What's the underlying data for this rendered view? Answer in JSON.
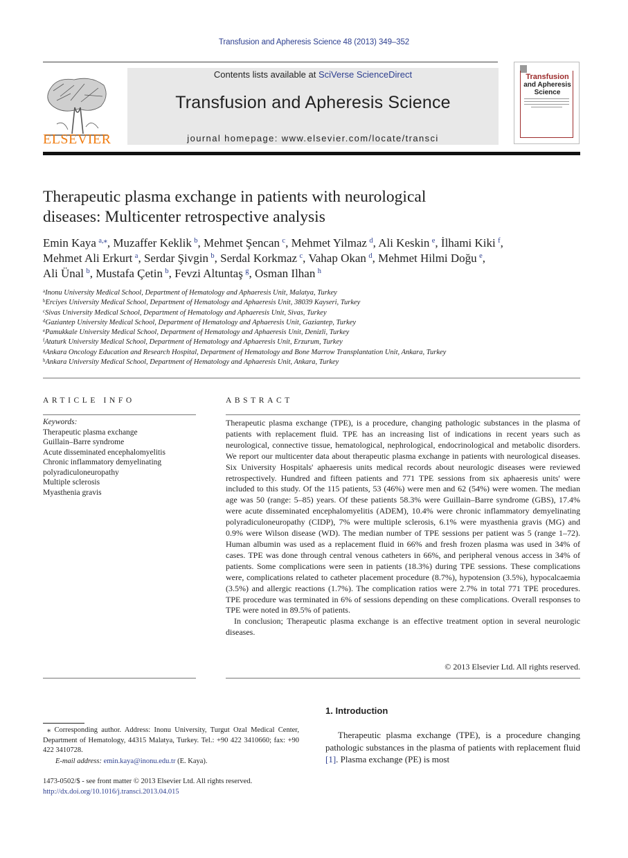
{
  "running_head": "Transfusion and Apheresis Science 48 (2013) 349–352",
  "masthead": {
    "publisher_logo_text": "ELSEVIER",
    "contents_prefix": "Contents lists available at ",
    "contents_link": "SciVerse ScienceDirect",
    "journal_title": "Transfusion and Apheresis Science",
    "homepage_label": "journal homepage: ",
    "homepage_url": "www.elsevier.com/locate/transci",
    "cover": {
      "line1": "Transfusion",
      "line2": "and Apheresis",
      "line3": "Science"
    },
    "accent_color": "#f07c10",
    "link_color": "#2c3e8f"
  },
  "article": {
    "title_line1": "Therapeutic plasma exchange in patients with neurological",
    "title_line2": "diseases: Multicenter retrospective analysis",
    "authors": [
      {
        "name": "Emin Kaya",
        "sup": "a,⁎",
        "sep": ", "
      },
      {
        "name": "Muzaffer Keklik",
        "sup": "b",
        "sep": ", "
      },
      {
        "name": "Mehmet Şencan",
        "sup": "c",
        "sep": ", "
      },
      {
        "name": "Mehmet Yilmaz",
        "sup": "d",
        "sep": ", "
      },
      {
        "name": "Ali Keskin",
        "sup": "e",
        "sep": ", "
      },
      {
        "name": "İlhami Kiki",
        "sup": "f",
        "sep": ","
      },
      {
        "name": "Mehmet Ali Erkurt",
        "sup": "a",
        "sep": ", "
      },
      {
        "name": "Serdar Şivgin",
        "sup": "b",
        "sep": ", "
      },
      {
        "name": "Serdal Korkmaz",
        "sup": "c",
        "sep": ", "
      },
      {
        "name": "Vahap Okan",
        "sup": "d",
        "sep": ", "
      },
      {
        "name": "Mehmet Hilmi Doğu",
        "sup": "e",
        "sep": ","
      },
      {
        "name": "Ali Ünal",
        "sup": "b",
        "sep": ", "
      },
      {
        "name": "Mustafa Çetin",
        "sup": "b",
        "sep": ", "
      },
      {
        "name": "Fevzi Altuntaş",
        "sup": "g",
        "sep": ", "
      },
      {
        "name": "Osman Ilhan",
        "sup": "h",
        "sep": ""
      }
    ],
    "affiliations": [
      {
        "sup": "a",
        "text": "Inonu University Medical School, Department of Hematology and Aphaeresis Unit, Malatya, Turkey"
      },
      {
        "sup": "b",
        "text": "Erciyes University Medical School, Department of Hematology and Aphaeresis Unit, 38039 Kayseri, Turkey"
      },
      {
        "sup": "c",
        "text": "Sivas University Medical School, Department of Hematology and Aphaeresis Unit, Sivas, Turkey"
      },
      {
        "sup": "d",
        "text": "Gaziantep University Medical School, Department of Hematology and Aphaeresis Unit, Gaziantep, Turkey"
      },
      {
        "sup": "e",
        "text": "Pamukkale University Medical School, Department of Hematology and Aphaeresis Unit, Denizli, Turkey"
      },
      {
        "sup": "f",
        "text": "Ataturk University Medical School, Department of Hematology and Aphaeresis Unit, Erzurum, Turkey"
      },
      {
        "sup": "g",
        "text": "Ankara Oncology Education and Research Hospital, Department of Hematology and Bone Marrow Transplantation Unit, Ankara, Turkey"
      },
      {
        "sup": "h",
        "text": "Ankara University Medical School, Department of Hematology and Aphaeresis Unit, Ankara, Turkey"
      }
    ]
  },
  "article_info": {
    "heading": "ARTICLE INFO",
    "keywords_label": "Keywords:",
    "keywords": [
      "Therapeutic plasma exchange",
      "Guillain–Barre syndrome",
      "Acute disseminated encephalomyelitis",
      "Chronic inflammatory demyelinating",
      "polyradiculoneuropathy",
      "Multiple sclerosis",
      "Myasthenia gravis"
    ]
  },
  "abstract": {
    "heading": "ABSTRACT",
    "paragraph1": "Therapeutic plasma exchange (TPE), is a procedure, changing pathologic substances in the plasma of patients with replacement fluid. TPE has an increasing list of indications in recent years such as neurological, connective tissue, hematological, nephrological, endocrinological and metabolic disorders. We report our multicenter data about therapeutic plasma exchange in patients with neurological diseases. Six University Hospitals' aphaeresis units medical records about neurologic diseases were reviewed retrospectively. Hundred and fifteen patients and 771 TPE sessions from six aphaeresis units' were included to this study. Of the 115 patients, 53 (46%) were men and 62 (54%) were women. The median age was 50 (range: 5–85) years. Of these patients 58.3% were Guillain–Barre syndrome (GBS), 17.4% were acute disseminated encephalomyelitis (ADEM), 10.4% were chronic inflammatory demyelinating polyradiculoneuropathy (CIDP), 7% were multiple sclerosis, 6.1% were myasthenia gravis (MG) and 0.9% were Wilson disease (WD). The median number of TPE sessions per patient was 5 (range 1–72). Human albumin was used as a replacement fluid in 66% and fresh frozen plasma was used in 34% of cases. TPE was done through central venous catheters in 66%, and peripheral venous access in 34% of patients. Some complications were seen in patients (18.3%) during TPE sessions. These complications were, complications related to catheter placement procedure (8.7%), hypotension (3.5%), hypocalcaemia (3.5%) and allergic reactions (1.7%). The complication ratios were 2.7% in total 771 TPE procedures. TPE procedure was terminated in 6% of sessions depending on these complications. Overall responses to TPE were noted in 89.5% of patients.",
    "paragraph2": "In conclusion; Therapeutic plasma exchange is an effective treatment option in several neurologic diseases.",
    "copyright": "© 2013 Elsevier Ltd. All rights reserved."
  },
  "footnote": {
    "corresponding": "⁎ Corresponding author. Address: Inonu University, Turgut Ozal Medical Center, Department of Hematology, 44315 Malatya, Turkey. Tel.: +90 422 3410660; fax: +90 422 3410728.",
    "email_label": "E-mail address: ",
    "email": "emin.kaya@inonu.edu.tr",
    "email_suffix": " (E. Kaya).",
    "front_matter": "1473-0502/$ - see front matter © 2013 Elsevier Ltd. All rights reserved.",
    "doi": "http://dx.doi.org/10.1016/j.transci.2013.04.015"
  },
  "introduction": {
    "heading": "1. Introduction",
    "text_before_ref": "Therapeutic plasma exchange (TPE), is a procedure changing pathologic substances in the plasma of patients with replacement fluid ",
    "ref": "[1]",
    "text_after_ref": ". Plasma exchange (PE) is most"
  }
}
